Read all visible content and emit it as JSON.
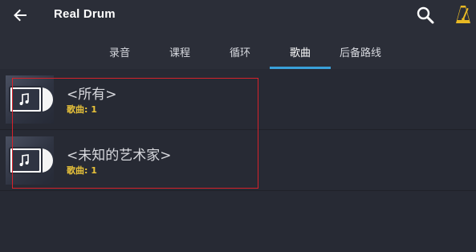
{
  "header": {
    "title": "Real Drum",
    "back_icon": "arrow-left-icon",
    "search_icon": "search-icon",
    "metronome_icon": "metronome-icon"
  },
  "tabs": [
    {
      "label": "录音",
      "active": false
    },
    {
      "label": "课程",
      "active": false
    },
    {
      "label": "循环",
      "active": false
    },
    {
      "label": "歌曲",
      "active": true
    },
    {
      "label": "后备路线",
      "active": false
    }
  ],
  "artists": [
    {
      "name": "<所有>",
      "songs": "歌曲: 1"
    },
    {
      "name": "<未知的艺术家>",
      "songs": "歌曲: 1"
    }
  ],
  "colors": {
    "background": "#272a34",
    "tab_indicator": "#39a0d9",
    "song_count": "#e8c23a",
    "metronome": "#e8b923",
    "annotation_box": "#d6232b"
  }
}
